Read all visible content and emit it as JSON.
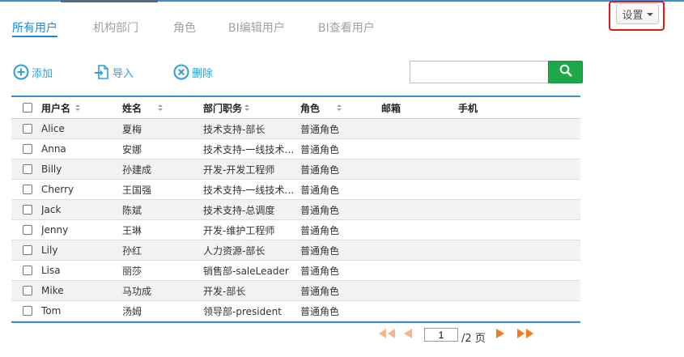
{
  "tabs": [
    {
      "label": "所有用户",
      "active": true
    },
    {
      "label": "机构部门",
      "active": false
    },
    {
      "label": "角色",
      "active": false
    },
    {
      "label": "BI编辑用户",
      "active": false
    },
    {
      "label": "BI查看用户",
      "active": false
    }
  ],
  "settings": {
    "label": "设置",
    "icon": "caret-down-icon"
  },
  "toolbar": {
    "add_label": "添加",
    "import_label": "导入",
    "delete_label": "删除"
  },
  "search": {
    "value": "",
    "placeholder": "",
    "icon": "search-icon"
  },
  "table": {
    "headers": [
      "用户名",
      "姓名",
      "部门职务",
      "角色",
      "邮箱",
      "手机"
    ],
    "rows": [
      [
        "Alice",
        "夏梅",
        "技术支持-部长",
        "普通角色",
        "",
        ""
      ],
      [
        "Anna",
        "安娜",
        "技术支持-一线技术…",
        "普通角色",
        "",
        ""
      ],
      [
        "Billy",
        "孙建成",
        "开发-开发工程师",
        "普通角色",
        "",
        ""
      ],
      [
        "Cherry",
        "王国强",
        "技术支持-一线技术…",
        "普通角色",
        "",
        ""
      ],
      [
        "Jack",
        "陈斌",
        "技术支持-总调度",
        "普通角色",
        "",
        ""
      ],
      [
        "Jenny",
        "王琳",
        "开发-维护工程师",
        "普通角色",
        "",
        ""
      ],
      [
        "Lily",
        "孙红",
        "人力资源-部长",
        "普通角色",
        "",
        ""
      ],
      [
        "Lisa",
        "丽莎",
        "销售部-saleLeader",
        "普通角色",
        "",
        ""
      ],
      [
        "Mike",
        "马功成",
        "开发-部长",
        "普通角色",
        "",
        ""
      ],
      [
        "Tom",
        "汤姆",
        "领导部-president",
        "普通角色",
        "",
        ""
      ]
    ]
  },
  "pagination": {
    "current_page": "1",
    "total_label": "/2 页"
  },
  "colors": {
    "accent": "#1f87d6",
    "search_button": "#1fa84a",
    "pager_arrow": "#f47b20",
    "highlight_box": "#e01818"
  }
}
